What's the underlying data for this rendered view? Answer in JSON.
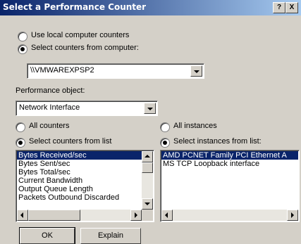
{
  "window": {
    "title": "Select a Performance Counter",
    "help_label": "?",
    "close_label": "X"
  },
  "source": {
    "use_local_label": "Use local computer counters",
    "select_from_computer_label": "Select counters from computer:",
    "selected": "select_from_computer",
    "computer_value": "\\\\VMWAREXPSP2"
  },
  "performance_object": {
    "label": "Performance object:",
    "value": "Network Interface"
  },
  "counters": {
    "all_label": "All counters",
    "from_list_label": "Select counters from list",
    "selected": "from_list",
    "items": [
      "Bytes Received/sec",
      "Bytes Sent/sec",
      "Bytes Total/sec",
      "Current Bandwidth",
      "Output Queue Length",
      "Packets Outbound Discarded"
    ],
    "selected_item": "Bytes Received/sec"
  },
  "instances": {
    "all_label": "All instances",
    "from_list_label": "Select instances from list:",
    "selected": "from_list",
    "items": [
      "AMD PCNET Family PCI Ethernet A",
      "MS TCP Loopback interface"
    ],
    "selected_item": "AMD PCNET Family PCI Ethernet A"
  },
  "buttons": {
    "ok_label": "OK",
    "explain_label": "Explain"
  }
}
